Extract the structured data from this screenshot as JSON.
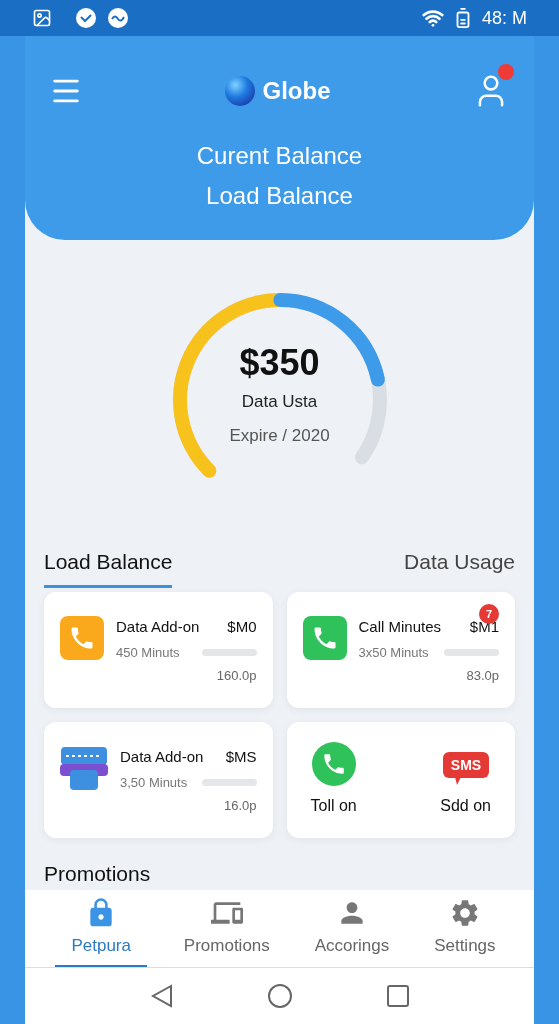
{
  "status_bar": {
    "time": "48: M"
  },
  "header": {
    "brand": "Globe",
    "has_notification": true,
    "lines": [
      "Curent Balance",
      "Load Balance"
    ]
  },
  "gauge": {
    "amount": "$350",
    "label": "Data Usta",
    "expiry": "Expire / 2020"
  },
  "tabs": [
    {
      "label": "Load Balance",
      "selected": true
    },
    {
      "label": "Data Usage",
      "selected": false
    }
  ],
  "cards": [
    {
      "kind": "item",
      "title": "Data Add-on",
      "price": "$M0",
      "detail": "450 Minuts",
      "amount": "160.0p"
    },
    {
      "kind": "item",
      "title": "Call Minutes",
      "price": "$M1",
      "detail": "3x50 Minuts",
      "amount": "83.0p",
      "badge": "7"
    },
    {
      "kind": "item",
      "title": "Data Add-on",
      "price": "$MS",
      "detail": "3,50 Minuts",
      "amount": "16.0p"
    },
    {
      "kind": "quick",
      "actions": [
        {
          "label": "Toll on"
        },
        {
          "icon_text": "SMS",
          "label": "Sdd on"
        }
      ]
    }
  ],
  "section_title": "Promotions",
  "bottom_nav": [
    {
      "label": "Petpura",
      "selected": true
    },
    {
      "label": "Promotions",
      "selected": false
    },
    {
      "label": "Accorings",
      "selected": false
    },
    {
      "label": "Settings",
      "selected": false
    }
  ]
}
